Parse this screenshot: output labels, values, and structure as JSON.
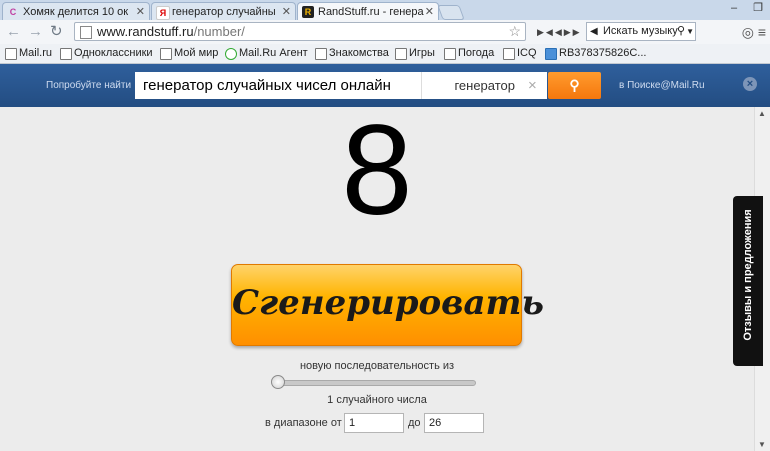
{
  "browser": {
    "tabs": [
      {
        "title": "Хомяк делится 10 ок",
        "favicon": "hamster-favicon"
      },
      {
        "title": "генератор случайны",
        "favicon": "yandex-favicon"
      },
      {
        "title": "RandStuff.ru - генера",
        "favicon": "randstuff-favicon"
      }
    ],
    "url_domain": "www.randstuff.ru",
    "url_path": "/number/",
    "music_placeholder": "Искать музыку",
    "bookmarks": [
      "Mail.ru",
      "Одноклассники",
      "Мой мир",
      "Mail.Ru Агент",
      "Знакомства",
      "Игры",
      "Погода",
      "ICQ",
      "RB378375826C..."
    ]
  },
  "searchbar": {
    "try_label": "Попробуйте найти",
    "query": "генератор случайных чисел онлайн",
    "category": "генератор",
    "in_mail_label": "в Поиске@Mail.Ru"
  },
  "main": {
    "result": "8",
    "generate_label": "Сгенерировать",
    "sequence_label": "новую последовательность из",
    "count_label": "1 случайного числа",
    "range_from_label": "в диапазоне от",
    "range_from_value": "1",
    "range_to_label": "до",
    "range_to_value": "26",
    "feedback_label": "Отзывы и предложения",
    "slider_value": 1
  },
  "colors": {
    "accent": "#ff9500",
    "search_bar": "#2a5690"
  }
}
